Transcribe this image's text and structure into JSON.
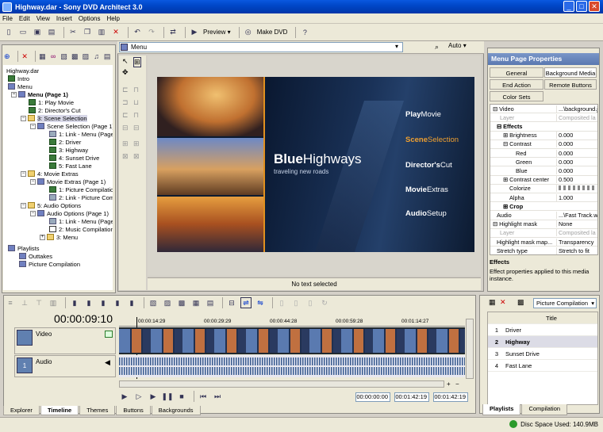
{
  "window": {
    "title": "Highway.dar - Sony DVD Architect 3.0"
  },
  "menubar": [
    "File",
    "Edit",
    "View",
    "Insert",
    "Options",
    "Help"
  ],
  "toolbar": {
    "preview_label": "Preview",
    "make_dvd_label": "Make DVD"
  },
  "explorer": {
    "root": "Highway.dar",
    "nodes": [
      {
        "label": "Intro",
        "icon": "film-icon"
      },
      {
        "label": "Menu",
        "icon": "menu-icon"
      },
      {
        "label": "Menu (Page 1)",
        "icon": "menu-icon"
      },
      {
        "label": "1: Play Movie",
        "icon": "film-icon"
      },
      {
        "label": "2: Director's Cut",
        "icon": "film-icon"
      },
      {
        "label": "3: Scene Selection",
        "icon": "folder-icon"
      },
      {
        "label": "Scene Selection (Page 1)",
        "icon": "menu-icon"
      },
      {
        "label": "1: Link - Menu (Page",
        "icon": "link-icon"
      },
      {
        "label": "2: Driver",
        "icon": "film-icon"
      },
      {
        "label": "3: Highway",
        "icon": "film-icon"
      },
      {
        "label": "4: Sunset Drive",
        "icon": "film-icon"
      },
      {
        "label": "5: Fast Lane",
        "icon": "film-icon"
      },
      {
        "label": "4: Movie Extras",
        "icon": "folder-icon"
      },
      {
        "label": "Movie Extras (Page 1)",
        "icon": "menu-icon"
      },
      {
        "label": "1: Picture Compilation",
        "icon": "film-icon"
      },
      {
        "label": "2: Link - Picture Comp",
        "icon": "link-icon"
      },
      {
        "label": "5: Audio Options",
        "icon": "folder-icon"
      },
      {
        "label": "Audio Options (Page 1)",
        "icon": "menu-icon"
      },
      {
        "label": "1: Link - Menu (Page",
        "icon": "link-icon"
      },
      {
        "label": "2: Music Compilation",
        "icon": "music-icon"
      },
      {
        "label": "3: Menu",
        "icon": "folder-icon"
      },
      {
        "label": "Playlists",
        "icon": "menu-icon"
      },
      {
        "label": "Outtakes",
        "icon": "menu-icon"
      },
      {
        "label": "Picture Compilation",
        "icon": "menu-icon"
      }
    ]
  },
  "editor": {
    "menu_select": "Menu",
    "zoom": "Auto",
    "status": "No text selected",
    "stage": {
      "title_a": "Blue",
      "title_b": "Highways",
      "subtitle": "traveling new roads",
      "buttons": [
        {
          "a": "Play",
          "b": "Movie"
        },
        {
          "a": "Scene",
          "b": "Selection"
        },
        {
          "a": "Director's",
          "b": "Cut"
        },
        {
          "a": "Movie",
          "b": "Extras"
        },
        {
          "a": "Audio",
          "b": "Setup"
        }
      ]
    }
  },
  "properties": {
    "title": "Menu Page Properties",
    "tabs": [
      "General",
      "Background Media",
      "End Action",
      "Remote Buttons",
      "Color Sets"
    ],
    "rows": [
      {
        "k": "Video",
        "v": "...\\background.j"
      },
      {
        "k": "Layer",
        "v": "Composited la"
      },
      {
        "k": "Effects",
        "v": ""
      },
      {
        "k": "Brightness",
        "v": "0.000"
      },
      {
        "k": "Contrast",
        "v": "0.000"
      },
      {
        "k": "Red",
        "v": "0.000"
      },
      {
        "k": "Green",
        "v": "0.000"
      },
      {
        "k": "Blue",
        "v": "0.000"
      },
      {
        "k": "Contrast center",
        "v": "0.500"
      },
      {
        "k": "Colorize",
        "v": ""
      },
      {
        "k": "Alpha",
        "v": "1.000"
      },
      {
        "k": "Crop",
        "v": ""
      },
      {
        "k": "Audio",
        "v": "...\\Fast Track.wa"
      },
      {
        "k": "Highlight mask",
        "v": "None"
      },
      {
        "k": "Layer",
        "v": "Composited la"
      },
      {
        "k": "Highlight mask map...",
        "v": "Transparency"
      },
      {
        "k": "Stretch type",
        "v": "Stretch to fit"
      }
    ],
    "desc_title": "Effects",
    "desc_text": "Effect properties applied to this media instance."
  },
  "timeline": {
    "timecode": "00:00:09:10",
    "ruler": [
      "00:00:14:29",
      "00:00:29:29",
      "00:00:44:28",
      "00:00:59:28",
      "00:01:14:27"
    ],
    "video_label": "Video",
    "audio_label": "Audio",
    "audio_num": "1",
    "tc_start": "00:00:00:00",
    "tc_end": "00:01:42:19",
    "tc_len": "00:01:42:19"
  },
  "bottom_tabs": [
    "Explorer",
    "Timeline",
    "Themes",
    "Buttons",
    "Backgrounds"
  ],
  "playlists": {
    "select": "Picture Compilation",
    "header": "Title",
    "rows": [
      {
        "n": "1",
        "t": "Driver"
      },
      {
        "n": "2",
        "t": "Highway"
      },
      {
        "n": "3",
        "t": "Sunset Drive"
      },
      {
        "n": "4",
        "t": "Fast Lane"
      }
    ],
    "tabs": [
      "Playlists",
      "Compilation"
    ]
  },
  "status": {
    "disc": "Disc Space Used: 140.9MB"
  }
}
